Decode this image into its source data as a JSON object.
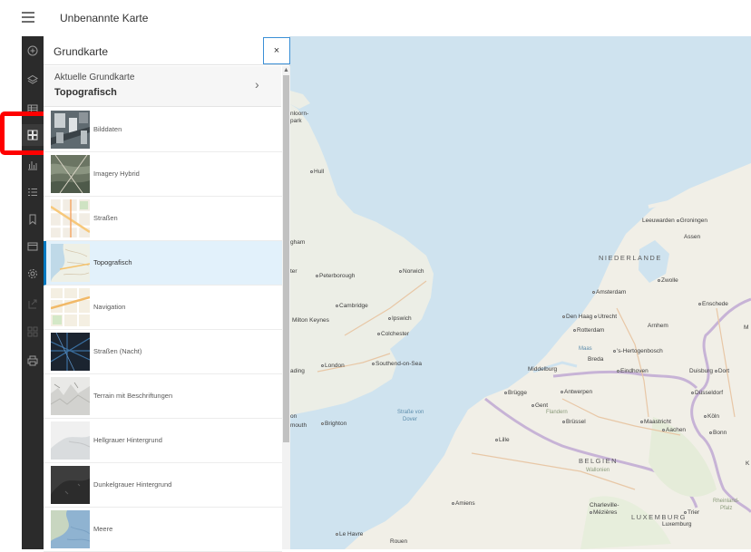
{
  "app": {
    "title": "Unbenannte Karte"
  },
  "panel": {
    "title": "Grundkarte",
    "close_label": "×",
    "current_label": "Aktuelle Grundkarte",
    "current_value": "Topografisch"
  },
  "basemaps": [
    {
      "name": "Bilddaten",
      "thumb": "imagery"
    },
    {
      "name": "Imagery Hybrid",
      "thumb": "hybrid"
    },
    {
      "name": "Straßen",
      "thumb": "streets"
    },
    {
      "name": "Topografisch",
      "thumb": "topo",
      "selected": true
    },
    {
      "name": "Navigation",
      "thumb": "navigation"
    },
    {
      "name": "Straßen (Nacht)",
      "thumb": "night"
    },
    {
      "name": "Terrain mit Beschriftungen",
      "thumb": "terrain"
    },
    {
      "name": "Hellgrauer Hintergrund",
      "thumb": "lightgray"
    },
    {
      "name": "Dunkelgrauer Hintergrund",
      "thumb": "darkgray"
    },
    {
      "name": "Meere",
      "thumb": "oceans"
    }
  ],
  "toolbar_icons": [
    "add-icon",
    "layers-icon",
    "table-icon",
    "basemap-gallery-icon",
    "chart-icon",
    "legend-icon",
    "bookmark-icon",
    "details-icon",
    "settings-icon",
    "share-icon",
    "apps-icon",
    "print-icon"
  ],
  "map": {
    "labels": {
      "hull": "Hull",
      "leeuwarden": "Leeuwarden",
      "groningen": "Groningen",
      "assen": "Assen",
      "niederlande": "NIEDERLANDE",
      "peterborough": "Peterborough",
      "norwich": "Norwich",
      "zwolle": "Zwolle",
      "amsterdam": "Amsterdam",
      "cambridge": "Cambridge",
      "enschede": "Enschede",
      "milton_keynes": "Milton Keynes",
      "ipswich": "Ipswich",
      "den_haag": "Den Haag",
      "utrecht": "Utrecht",
      "arnhem": "Arnhem",
      "colchester": "Colchester",
      "rotterdam": "Rotterdam",
      "hertogenbosch": "'s-Hertogenbosch",
      "london": "London",
      "southend": "Southend-on-Sea",
      "middelburg": "Middelburg",
      "breda": "Breda",
      "eindhoven": "Eindhoven",
      "duisburg": "Duisburg",
      "dortmund": "Dort",
      "brugge": "Brügge",
      "antwerpen": "Antwerpen",
      "duesseldorf": "Düsseldorf",
      "gent": "Gent",
      "flandern": "Flandern",
      "strasse_von_dover": "Straße von",
      "dover": "Dover",
      "brighton": "Brighton",
      "bruessel": "Brüssel",
      "maastricht": "Maastricht",
      "aachen": "Aachen",
      "koeln": "Köln",
      "bonn": "Bonn",
      "lille": "Lille",
      "belgien": "BELGIEN",
      "wallonien": "Wallonien",
      "amiens": "Amiens",
      "charleville": "Charleville-",
      "mezieres": "Mézières",
      "luxemburg_country": "LUXEMBURG",
      "trier": "Trier",
      "luxemburg_city": "Luxemburg",
      "rheinland": "Rheinland-",
      "pfalz": "Pfalz",
      "le_havre": "Le Havre",
      "rouen": "Rouen",
      "maas": "Maas",
      "gham": "gham",
      "ter": "ter",
      "ading": "ading",
      "mouth": "mouth",
      "on": "on",
      "nloorn": "nloorn-",
      "park": "park",
      "m_edge": "M",
      "k_edge": "K"
    }
  }
}
